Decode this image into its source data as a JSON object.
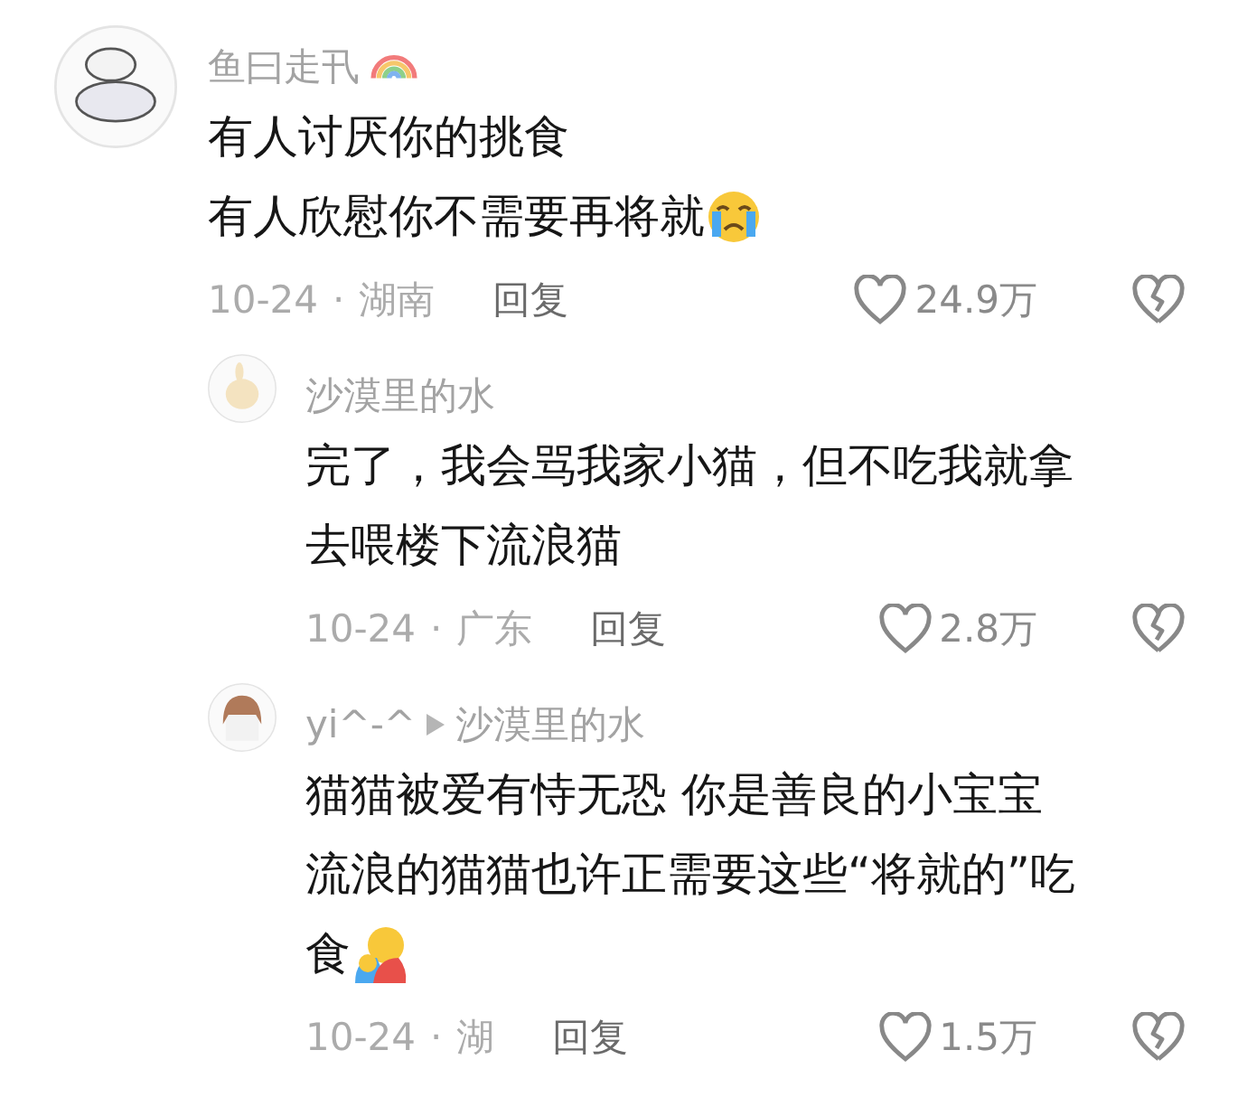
{
  "comments": [
    {
      "author": "鱼曰走卂",
      "author_icon": {
        "kind": "rainbow"
      },
      "lines": [
        "有人讨厌你的挑食",
        "有人欣慰你不需要再将就"
      ],
      "text_icon": {
        "kind": "crying"
      },
      "date": "10-24",
      "separator": "·",
      "location": "湖南",
      "reply": "回复",
      "likes": "24.9万",
      "avatar": {
        "kind": "picture"
      },
      "replies": [
        {
          "author": "沙漠里的水",
          "lines": [
            "完了，我会骂我家小猫，但不吃我就拿",
            "去喂楼下流浪猫"
          ],
          "date": "10-24",
          "separator": "·",
          "location": "广东",
          "reply": "回复",
          "likes": "2.8万",
          "avatar": {
            "kind": "picture"
          }
        },
        {
          "author": "yi^-^",
          "reply_to": "沙漠里的水",
          "lines": [
            "猫猫被爱有恃无恐 你是善良的小宝宝",
            "流浪的猫猫也许正需要这些“将就的”吃",
            "食"
          ],
          "text_icon": {
            "kind": "hugging"
          },
          "date": "10-24",
          "separator": "·",
          "location": "湖",
          "reply": "回复",
          "likes": "1.5万",
          "avatar": {
            "kind": "picture"
          }
        }
      ]
    }
  ]
}
